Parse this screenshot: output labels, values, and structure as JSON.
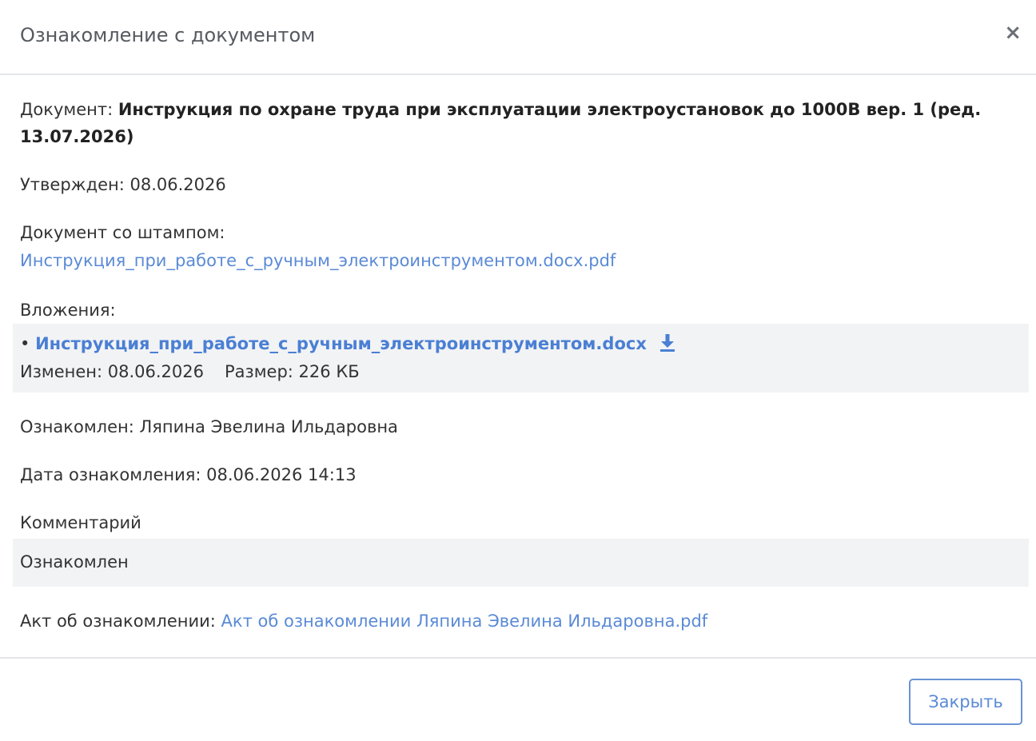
{
  "dialog": {
    "title": "Ознакомление с документом",
    "close_icon": "×"
  },
  "document": {
    "label": "Документ: ",
    "name": "Инструкция по охране труда при эксплуатации электроустановок до 1000В вер. 1 (ред. 13.07.2026)"
  },
  "approved": "Утвержден: 08.06.2026",
  "stamped": {
    "label": "Документ со штампом:",
    "file": "Инструкция_при_работе_с_ручным_электроинструментом.docx.pdf"
  },
  "attachments": {
    "label": "Вложения:",
    "bullet": "•",
    "items": [
      {
        "name": "Инструкция_при_работе_с_ручным_электроинструментом.docx",
        "modified": "Изменен: 08.06.2026",
        "size": "Размер: 226 КБ",
        "icon": "download-icon"
      }
    ]
  },
  "acquainted": "Ознакомлен: Ляпина Эвелина Ильдаровна",
  "acquaint_date": "Дата ознакомления: 08.06.2026 14:13",
  "comment": {
    "label": "Комментарий",
    "text": "Ознакомлен"
  },
  "act": {
    "label": "Акт об ознакомлении: ",
    "file": "Акт об ознакомлении Ляпина Эвелина Ильдаровна.pdf"
  },
  "footer": {
    "close_label": "Закрыть"
  },
  "colors": {
    "link": "#5a8ad6",
    "panel_bg": "#f2f3f5",
    "border": "#e3e5e8"
  }
}
